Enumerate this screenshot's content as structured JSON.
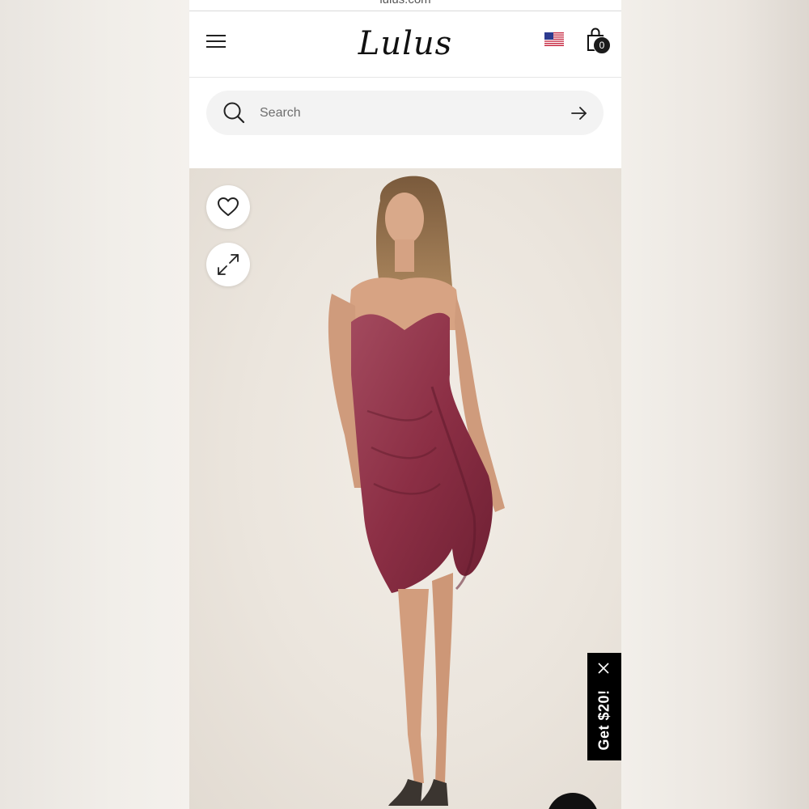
{
  "browser": {
    "url": "lulus.com"
  },
  "header": {
    "logo_text": "Lulus",
    "menu_icon": "hamburger-menu-icon",
    "flag_icon": "us-flag-icon",
    "cart_icon": "shopping-bag-icon",
    "cart_count": "0"
  },
  "search": {
    "placeholder": "Search",
    "value": "",
    "icon": "search-icon",
    "submit_icon": "arrow-right-icon"
  },
  "product": {
    "dress_color": "#8c2f45",
    "favorite_icon": "heart-icon",
    "expand_icon": "expand-icon"
  },
  "promo": {
    "label": "Get $20!",
    "close_icon": "close-icon"
  },
  "chat": {
    "icon": "chat-icon"
  }
}
